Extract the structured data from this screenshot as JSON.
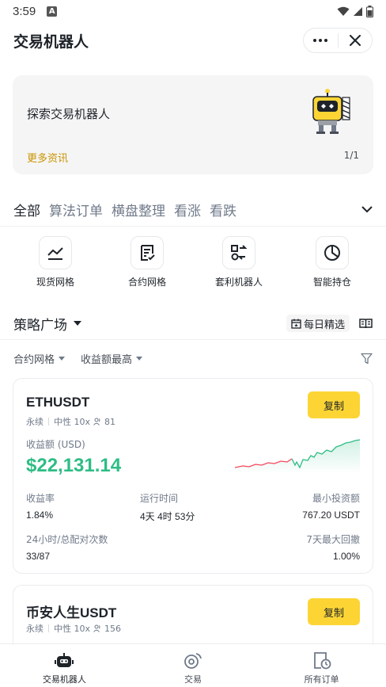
{
  "status_bar": {
    "time": "3:59",
    "notif_letter": "A"
  },
  "header": {
    "title": "交易机器人",
    "icons": [
      "more-icon",
      "close-icon"
    ]
  },
  "banner": {
    "title": "探索交易机器人",
    "more_link": "更多资讯",
    "page": "1/1"
  },
  "category_tabs": [
    "全部",
    "算法订单",
    "横盘整理",
    "看涨",
    "看跌"
  ],
  "quick_actions": [
    {
      "label": "现货网格",
      "icon": "grid-chart-icon"
    },
    {
      "label": "合约网格",
      "icon": "contract-doc-icon"
    },
    {
      "label": "套利机器人",
      "icon": "arbitrage-icon"
    },
    {
      "label": "智能持仓",
      "icon": "pie-icon"
    }
  ],
  "plaza": {
    "title": "策略广场",
    "daily_label": "每日精选"
  },
  "filters": {
    "type": "合约网格",
    "sort": "收益额最高"
  },
  "cards": [
    {
      "name": "ETHUSDT",
      "tag1": "永续",
      "tag2": "中性 10x",
      "users": "81",
      "copy_label": "复制",
      "pnl_label": "收益额 (USD)",
      "pnl": "$22,131.14",
      "stats": {
        "roi_label": "收益率",
        "roi": "1.84%",
        "runtime_label": "运行时间",
        "runtime": "4天 4时 53分",
        "min_label": "最小投资额",
        "min": "767.20 USDT",
        "matches_label": "24小时/总配对次数",
        "matches": "33/87",
        "mdd_label": "7天最大回撤",
        "mdd": "1.00%"
      }
    },
    {
      "name": "币安人生USDT",
      "tag1": "永续",
      "tag2": "中性 10x",
      "users": "156",
      "copy_label": "复制"
    }
  ],
  "bottom_nav": [
    {
      "label": "交易机器人",
      "icon": "robot-icon",
      "active": true
    },
    {
      "label": "交易",
      "icon": "trade-icon",
      "active": false
    },
    {
      "label": "所有订单",
      "icon": "orders-icon",
      "active": false
    }
  ],
  "colors": {
    "accent": "#fcd535",
    "link": "#c99400",
    "positive": "#2ebd85",
    "negative": "#f6465d"
  }
}
